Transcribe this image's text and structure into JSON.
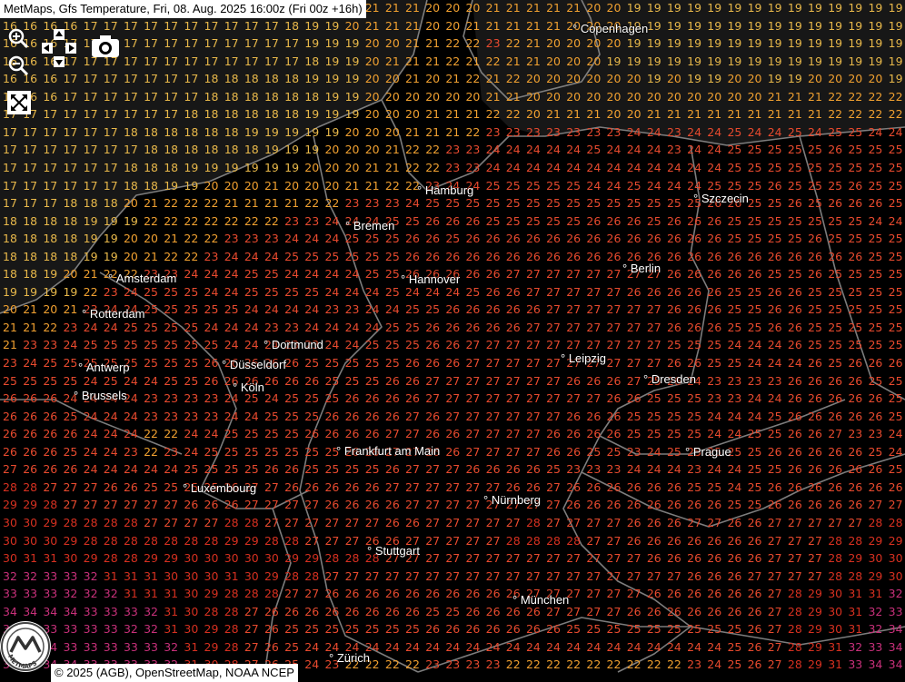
{
  "title": "MetMaps, Gfs Temperature, Fri, 08. Aug. 2025 16:00z (Fri 00z +16h)",
  "attribution": "© 2025 (AGB), OpenStreetMap, NOAA NCEP",
  "logo_text": "METMAPS",
  "controls": {
    "zoom_in": "zoom-in",
    "zoom_out": "zoom-out",
    "pan": "pan-arrows",
    "camera": "camera",
    "fullscreen": "fullscreen"
  },
  "colors": {
    "cold": "#e8b84a",
    "mild": "#f0a030",
    "warm": "#e84a2e",
    "hot": "#d63020",
    "veryhot": "#c8307a",
    "background": "#000000",
    "border": "#8a8a8a"
  },
  "cities": [
    {
      "name": "Copenhagen"
    },
    {
      "name": "Hamburg"
    },
    {
      "name": "Szczecin"
    },
    {
      "name": "Bremen"
    },
    {
      "name": "Berlin"
    },
    {
      "name": "Amsterdam"
    },
    {
      "name": "Hannover"
    },
    {
      "name": "Rotterdam"
    },
    {
      "name": "Dortmund"
    },
    {
      "name": "Leipzig"
    },
    {
      "name": "Antwerp"
    },
    {
      "name": "Düsseldorf"
    },
    {
      "name": "Dresden"
    },
    {
      "name": "Köln"
    },
    {
      "name": "Brussels"
    },
    {
      "name": "Frankfurt am Main"
    },
    {
      "name": "Prague"
    },
    {
      "name": "Luxembourg"
    },
    {
      "name": "Nürnberg"
    },
    {
      "name": "Stuttgart"
    },
    {
      "name": "München"
    },
    {
      "name": "Zürich"
    }
  ],
  "temperature_rows": [
    "16 16 16 16 17 17 17 17 17 17 17 17 17 18 19 19 20 20 21 21 21 20 20 20 21 21 21 21 21 20 20 19 19 19 19 19 19 19 19 19 19 19 19 19 19",
    "16 16 16 16 17 17 17 17 17 17 17 17 17 17 18 19 19 20 21 21 21 20 20 21 21 21 21 21 20 20 20 19 19 19 19 19 19 19 19 19 19 19 19 19 19",
    "16 16 16 17 17 17 17 17 17 17 17 17 17 17 17 19 19 19 20 20 21 21 22 22 23 22 21 20 20 20 20 19 19 19 19 19 19 19 19 19 19 19 19 19 19",
    "16 16 16 17 17 17 17 17 17 17 17 17 17 17 17 18 19 19 20 21 21 21 22 21 22 21 21 20 20 20 19 19 19 19 19 19 19 19 19 19 19 19 19 19 19",
    "16 16 16 17 17 17 17 17 17 17 18 18 18 18 18 19 19 19 20 20 21 20 21 22 21 22 20 20 20 20 20 20 19 20 19 19 20 20 19 19 20 20 20 20 19",
    "16 16 16 17 17 17 17 17 17 17 18 18 18 18 18 18 19 19 20 20 20 20 20 20 21 21 20 20 20 20 20 20 20 20 20 20 20 20 21 21 21 22 22 22 22",
    "17 17 17 17 17 17 17 17 17 18 18 18 18 18 18 19 19 19 20 20 20 21 21 21 22 22 20 21 21 21 20 20 21 21 21 21 21 21 21 21 21 22 22 22 22",
    "17 17 17 17 17 17 18 18 18 18 18 18 19 19 19 19 19 20 20 20 21 21 21 22 23 23 23 23 23 23 23 24 24 23 24 24 25 24 24 25 24 25 25 24 24",
    "17 17 17 17 17 17 17 18 18 18 18 18 18 19 19 19 20 20 20 21 22 22 23 23 24 24 24 24 24 25 24 24 24 23 24 24 25 25 25 25 25 26 25 25 25",
    "17 17 17 17 17 17 18 18 18 19 19 19 19 19 19 20 20 20 21 21 22 22 23 23 24 24 24 24 24 24 24 24 24 24 24 24 25 25 25 25 25 25 25 25 25",
    "17 17 17 17 17 17 18 18 19 19 20 20 20 21 20 20 20 21 21 22 22 23 24 24 25 25 25 25 25 24 24 25 24 24 24 25 25 25 26 25 25 25 26 25 25",
    "17 17 17 18 18 18 20 21 22 22 22 21 21 21 21 22 22 23 23 23 24 25 25 25 25 25 25 25 25 25 25 25 25 25 25 26 26 25 25 26 25 26 26 26 25",
    "18 18 18 18 19 19 19 22 22 22 22 22 22 22 23 23 24 24 24 25 25 26 26 26 25 25 25 25 25 26 26 26 25 26 26 26 25 25 25 25 25 25 25 24 24",
    "18 18 18 18 19 19 20 20 21 22 22 23 23 23 24 24 24 25 25 25 26 26 25 26 26 26 26 26 26 26 26 26 26 26 26 26 25 25 25 25 26 25 25 25 25",
    "18 18 18 18 19 19 20 21 22 22 23 24 24 24 25 25 25 25 25 25 26 26 26 26 26 26 26 26 26 26 26 26 26 26 26 26 26 26 26 26 26 26 26 25 25",
    "18 18 19 20 21 22 22 23 23 24 24 24 25 25 24 24 24 24 25 25 26 26 26 26 26 27 27 27 27 27 27 27 27 26 26 26 26 26 25 25 26 25 25 25 25",
    "19 19 19 19 22 23 24 25 25 25 24 24 25 25 25 25 24 24 24 25 24 24 24 25 26 26 27 27 27 27 27 26 26 26 26 26 25 25 26 26 25 25 25 25 25",
    "20 21 20 21 23 24 24 25 25 25 25 25 24 24 24 24 23 23 24 24 25 25 26 26 26 26 26 27 27 27 27 27 27 26 26 26 25 25 26 26 25 25 25 25 25",
    "21 21 22 23 24 24 25 25 25 25 24 24 24 23 23 24 24 24 24 25 25 26 26 26 26 26 27 27 27 27 27 27 27 26 26 26 25 25 26 26 25 25 25 25 25",
    "21 23 23 24 25 25 25 25 25 25 25 24 24 24 23 23 24 24 25 25 25 26 26 27 27 27 27 27 27 27 27 27 27 25 25 25 24 24 24 26 25 25 25 25 25",
    "23 24 25 25 25 25 25 25 25 25 26 26 26 26 26 25 25 25 25 25 26 26 26 27 27 27 27 27 27 27 27 27 27 26 26 25 25 24 24 24 26 25 26 26 26",
    "25 25 25 25 24 25 24 24 25 25 26 26 26 26 26 26 25 25 25 26 26 27 27 27 27 27 27 27 26 26 26 27 25 26 24 23 23 23 23 26 26 26 26 25 25",
    "26 26 26 24 24 24 24 23 23 23 23 24 25 24 25 25 25 26 26 26 26 27 27 27 27 27 27 27 27 27 26 26 25 25 25 23 23 24 24 26 26 26 26 26 25",
    "26 26 26 25 24 24 24 23 23 23 23 24 24 25 25 25 26 26 26 26 27 26 27 27 27 27 27 27 26 26 26 25 25 25 25 24 24 24 25 26 26 26 26 26 25",
    "26 26 26 26 24 24 24 22 22 24 24 25 25 25 25 26 26 26 26 27 27 26 26 27 27 27 27 26 26 26 26 25 25 25 25 24 24 25 25 26 26 27 23 23 24",
    "26 26 26 25 24 24 23 22 23 24 25 25 25 25 25 25 25 26 26 27 27 26 26 27 27 27 27 26 26 25 25 23 24 25 25 25 25 25 26 26 26 26 26 25 24",
    "27 26 26 26 24 24 24 24 24 25 25 25 25 26 26 25 25 25 25 26 27 27 27 26 26 26 26 25 23 23 23 24 24 24 23 24 24 25 25 26 26 26 26 26 25",
    "28 28 27 27 27 26 26 25 25 25 25 26 27 27 26 26 26 26 26 27 27 27 27 27 27 26 26 27 26 26 26 26 26 26 25 25 24 25 26 26 26 26 26 26 26",
    "29 29 28 27 27 27 27 27 27 26 26 26 27 27 27 27 26 26 26 26 27 27 27 27 27 27 27 27 26 26 26 26 26 26 26 26 25 25 26 26 26 26 26 27 27",
    "30 30 29 28 28 28 28 27 27 27 27 28 28 27 27 27 27 27 27 26 26 27 27 27 27 27 28 27 27 27 27 26 26 26 27 27 26 26 27 27 27 27 27 28 28",
    "30 30 30 29 28 28 28 28 28 28 28 29 29 28 28 27 27 27 26 26 27 27 27 27 27 28 28 28 28 27 27 26 26 26 26 26 26 26 27 27 27 28 28 29 29",
    "30 31 31 30 29 28 28 29 29 30 30 30 30 30 29 29 28 28 28 27 27 27 27 27 27 27 27 27 27 27 27 27 26 26 26 26 26 26 27 27 27 28 29 30 30",
    "32 32 33 33 32 31 31 31 30 30 30 31 30 29 28 28 27 27 27 27 27 27 27 27 27 27 27 27 27 27 27 27 27 27 26 26 26 27 27 27 27 28 28 29 30",
    "33 33 33 32 32 32 31 31 31 30 29 28 28 28 27 27 26 26 26 26 26 26 26 26 26 26 27 27 27 27 27 27 26 26 26 26 26 26 27 28 29 30 31 31 32",
    "34 34 34 34 33 33 33 32 31 30 28 28 27 26 26 26 26 26 26 26 26 25 25 26 26 26 26 27 27 27 27 26 26 26 26 26 26 26 27 28 29 30 31 32 33",
    "34 34 33 33 33 33 32 32 31 30 29 28 27 26 25 25 25 25 25 25 25 26 26 26 26 26 26 26 25 25 25 25 25 25 25 25 25 26 27 28 29 30 31 32 34",
    "34 34 34 33 33 33 33 33 32 31 29 28 27 26 25 24 24 24 24 24 24 24 24 24 24 24 24 24 24 24 24 24 24 24 24 24 25 26 27 28 29 31 32 33 34",
    "34 34 34 34 33 33 33 33 32 31 30 28 27 26 25 24 23 22 22 22 22 23 23 23 23 22 22 22 22 22 22 22 22 22 23 24 25 26 27 28 29 31 33 34 34"
  ]
}
